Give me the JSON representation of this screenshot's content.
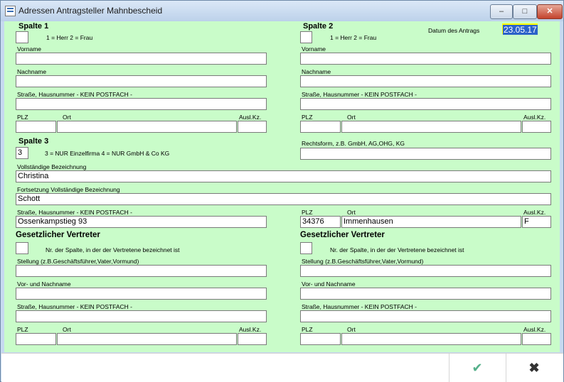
{
  "window": {
    "title": "Adressen Antragsteller Mahnbescheid",
    "min": "–",
    "max": "□",
    "close": "✕"
  },
  "date": {
    "label": "Datum des Antrags",
    "value": "23.05.17"
  },
  "spalte1": {
    "header": "Spalte 1",
    "anrede_value": "",
    "anrede_hint": "1 = Herr  2 = Frau",
    "vorname_label": "Vorname",
    "vorname": "",
    "nachname_label": "Nachname",
    "nachname": "",
    "strasse_label": "Straße, Hausnummer - KEIN POSTFACH -",
    "strasse": "",
    "plz_label": "PLZ",
    "plz": "",
    "ort_label": "Ort",
    "ort": "",
    "ausl_label": "Ausl.Kz.",
    "ausl": ""
  },
  "spalte2": {
    "header": "Spalte 2",
    "anrede_value": "",
    "anrede_hint": "1 = Herr  2 = Frau",
    "vorname_label": "Vorname",
    "vorname": "",
    "nachname_label": "Nachname",
    "nachname": "",
    "strasse_label": "Straße, Hausnummer - KEIN POSTFACH -",
    "strasse": "",
    "plz_label": "PLZ",
    "plz": "",
    "ort_label": "Ort",
    "ort": "",
    "ausl_label": "Ausl.Kz.",
    "ausl": ""
  },
  "spalte3": {
    "header": "Spalte 3",
    "art_value": "3",
    "art_hint": "3 = NUR Einzelfirma 4 = NUR GmbH & Co KG",
    "rechtsform_label": "Rechtsform, z.B. GmbH, AG,OHG, KG",
    "rechtsform": "",
    "bezeichnung_label": "Vollständige Bezeichnung",
    "bezeichnung": "Christina",
    "fortsetzung_label": "Fortsetzung Vollständige Bezeichnung",
    "fortsetzung": "Schott",
    "strasse_label": "Straße, Hausnummer - KEIN POSTFACH -",
    "strasse": "Ossenkampstieg 93",
    "plz_label": "PLZ",
    "plz": "34376",
    "ort_label": "Ort",
    "ort": "Immenhausen",
    "ausl_label": "Ausl.Kz.",
    "ausl": "F"
  },
  "vertreter1": {
    "header": "Gesetzlicher Vertreter",
    "nr_value": "",
    "nr_hint": "Nr. der Spalte, in der der Vertretene bezeichnet ist",
    "stellung_label": "Stellung (z.B.Geschäftsführer,Vater,Vormund)",
    "stellung": "",
    "name_label": "Vor- und Nachname",
    "name": "",
    "strasse_label": "Straße, Hausnummer - KEIN POSTFACH -",
    "strasse": "",
    "plz_label": "PLZ",
    "plz": "",
    "ort_label": "Ort",
    "ort": "",
    "ausl_label": "Ausl.Kz.",
    "ausl": ""
  },
  "vertreter2": {
    "header": "Gesetzlicher Vertreter",
    "nr_value": "",
    "nr_hint": "Nr. der Spalte, in der der Vertretene bezeichnet ist",
    "stellung_label": "Stellung (z.B.Geschäftsführer,Vater,Vormund)",
    "stellung": "",
    "name_label": "Vor- und Nachname",
    "name": "",
    "strasse_label": "Straße, Hausnummer - KEIN POSTFACH -",
    "strasse": "",
    "plz_label": "PLZ",
    "plz": "",
    "ort_label": "Ort",
    "ort": "",
    "ausl_label": "Ausl.Kz.",
    "ausl": ""
  },
  "buttons": {
    "ok": "✔",
    "cancel": "✖"
  },
  "colors": {
    "form_bg": "#c9fcc9",
    "date_bg": "#ffff00",
    "selection": "#2b62c8",
    "ok": "#55b08a"
  }
}
